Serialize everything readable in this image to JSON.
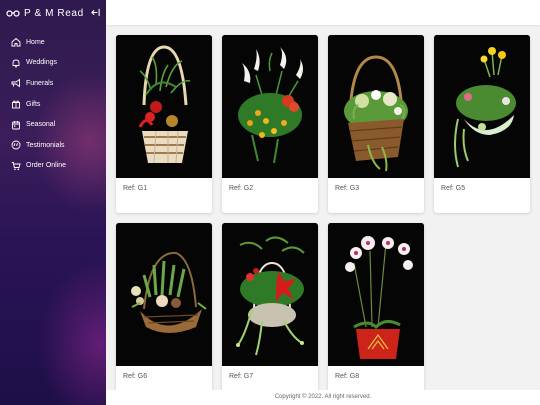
{
  "brand": {
    "title": "P & M Read",
    "logo_icon": "glasses-logo-icon",
    "collapse_icon": "collapse-sidebar-icon"
  },
  "nav": [
    {
      "label": "Home",
      "icon": "home-icon"
    },
    {
      "label": "Weddings",
      "icon": "bell-icon"
    },
    {
      "label": "Funerals",
      "icon": "trumpet-icon"
    },
    {
      "label": "Gifts",
      "icon": "gift-icon"
    },
    {
      "label": "Seasonal",
      "icon": "calendar-icon"
    },
    {
      "label": "Testimonials",
      "icon": "quote-icon"
    },
    {
      "label": "Order Online",
      "icon": "cart-icon"
    }
  ],
  "products": [
    {
      "ref": "Ref: G1"
    },
    {
      "ref": "Ref: G2"
    },
    {
      "ref": "Ref: G3"
    },
    {
      "ref": "Ref: G5"
    },
    {
      "ref": "Ref: G6"
    },
    {
      "ref": "Ref: G7"
    },
    {
      "ref": "Ref: G8"
    }
  ],
  "footer": {
    "copyright": "Copyright © 2022. All right reserved."
  },
  "colors": {
    "sidebar_dark": "#1d0f47",
    "sidebar_accent": "#9a2e8c",
    "card_bg": "#ffffff",
    "photo_bg": "#050505"
  }
}
